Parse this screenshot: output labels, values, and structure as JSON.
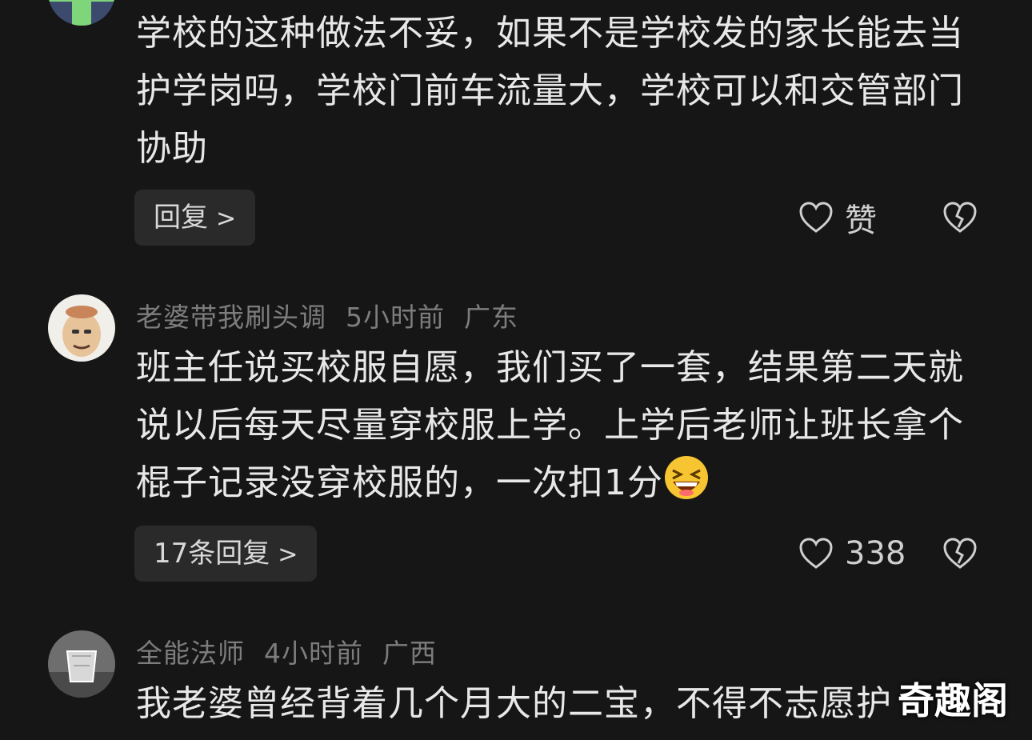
{
  "comments": [
    {
      "avatar_icon": "green-avatar-icon",
      "text": "学校的这种做法不妥，如果不是学校发的家长能去当护学岗吗，学校门前车流量大，学校可以和交管部门协助",
      "reply_label": "回复",
      "like_label": "赞"
    },
    {
      "author": "老婆带我刷头调",
      "time": "5小时前",
      "location": "广东",
      "avatar_icon": "man-face-avatar-icon",
      "text_before_emoji": "班主任说买校服自愿，我们买了一套，结果第二天就说以后每天尽量穿校服上学。上学后老师让班长拿个棍子记录没穿校服的，一次扣1分",
      "emoji_icon": "laughing-emoji-icon",
      "reply_label": "17条回复",
      "like_count": "338"
    },
    {
      "author": "全能法师",
      "time": "4小时前",
      "location": "广西",
      "avatar_icon": "glass-avatar-icon",
      "text": "我老婆曾经背着几个月大的二宝，不得不志愿护"
    }
  ],
  "watermark": "奇趣阁",
  "colors": {
    "background": "#161616",
    "meta_text": "#7d7d7d",
    "body_text": "#e8e8e8",
    "reply_button_bg": "#2a2a2a"
  }
}
